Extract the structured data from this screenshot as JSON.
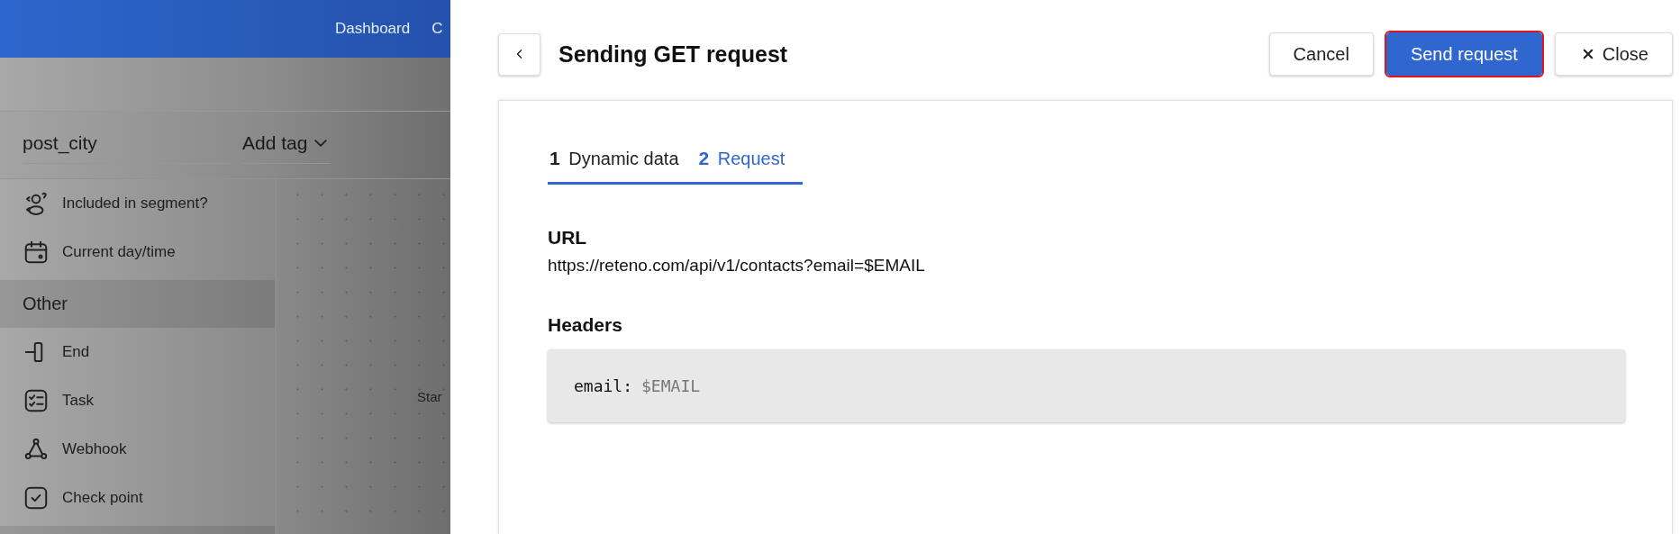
{
  "background_app": {
    "nav": [
      "Dashboard",
      "C"
    ],
    "tag_bar": {
      "name_field": "post_city",
      "tag_select": "Add tag"
    },
    "sidebar": {
      "items": [
        {
          "kind": "item",
          "label": "Included in segment?"
        },
        {
          "kind": "item",
          "label": "Current day/time"
        },
        {
          "kind": "header",
          "label": "Other"
        },
        {
          "kind": "item",
          "label": "End"
        },
        {
          "kind": "item",
          "label": "Task"
        },
        {
          "kind": "item",
          "label": "Webhook"
        },
        {
          "kind": "item",
          "label": "Check point"
        },
        {
          "kind": "header"
        }
      ]
    },
    "canvas": {
      "node_label": "Star"
    }
  },
  "drawer": {
    "title": "Sending GET request",
    "buttons": [
      {
        "kind": "default",
        "label": "Cancel",
        "focused": false
      },
      {
        "kind": "primary",
        "label": "Send request",
        "focused": true
      },
      {
        "kind": "close",
        "label": "Close",
        "focused": false
      }
    ],
    "steps": [
      {
        "number": "1",
        "label": "Dynamic data",
        "selected": false
      },
      {
        "number": "2",
        "label": "Request",
        "selected": true
      }
    ],
    "url_label": "URL",
    "url": "https://reteno.com/api/v1/contacts?email=$EMAIL",
    "headers_label": "Headers",
    "headers": [
      {
        "key": "email:",
        "value": "$EMAIL"
      }
    ]
  }
}
